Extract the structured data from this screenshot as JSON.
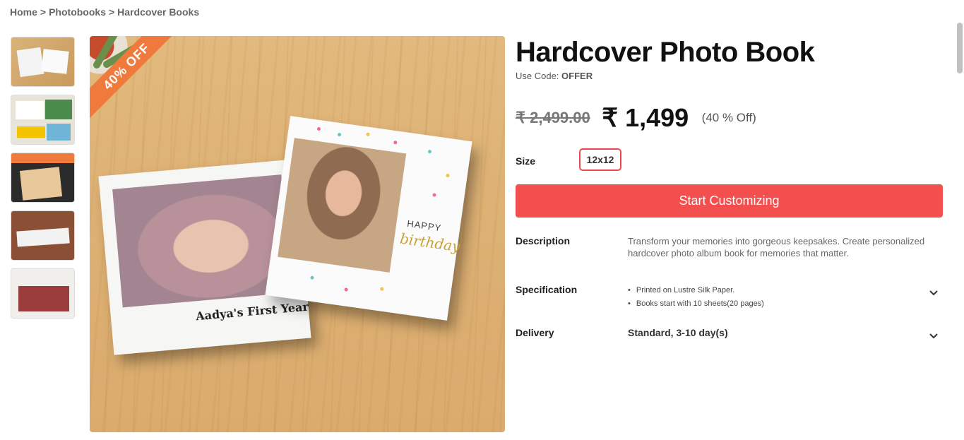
{
  "breadcrumb": {
    "home": "Home",
    "separator": ">",
    "photobooks": "Photobooks",
    "current": "Hardcover Books"
  },
  "gallery": {
    "ribbon": "40% OFF",
    "caption_left": "Aadya's First Year",
    "caption_right_top": "HAPPY",
    "caption_right_script": "birthday"
  },
  "product": {
    "title": "Hardcover Photo Book",
    "code_prefix": "Use Code:",
    "code": "OFFER",
    "old_price": "₹ 2,499.00",
    "new_price": "₹ 1,499",
    "discount": "(40 % Off)",
    "size_label": "Size",
    "size_value": "12x12",
    "cta_label": "Start Customizing",
    "description_label": "Description",
    "description_text": "Transform your memories into gorgeous keepsakes. Create personalized hardcover photo album book for memories that matter.",
    "specification_label": "Specification",
    "specifications": [
      "Printed on Lustre Silk Paper.",
      "Books start with 10 sheets(20 pages)"
    ],
    "delivery_label": "Delivery",
    "delivery_text": "Standard, 3-10 day(s)"
  },
  "colors": {
    "accent": "#f44f4f",
    "ribbon": "#f07a3c",
    "size_border": "#e9494f"
  },
  "icons": {
    "chevron": "chevron-down-icon"
  }
}
